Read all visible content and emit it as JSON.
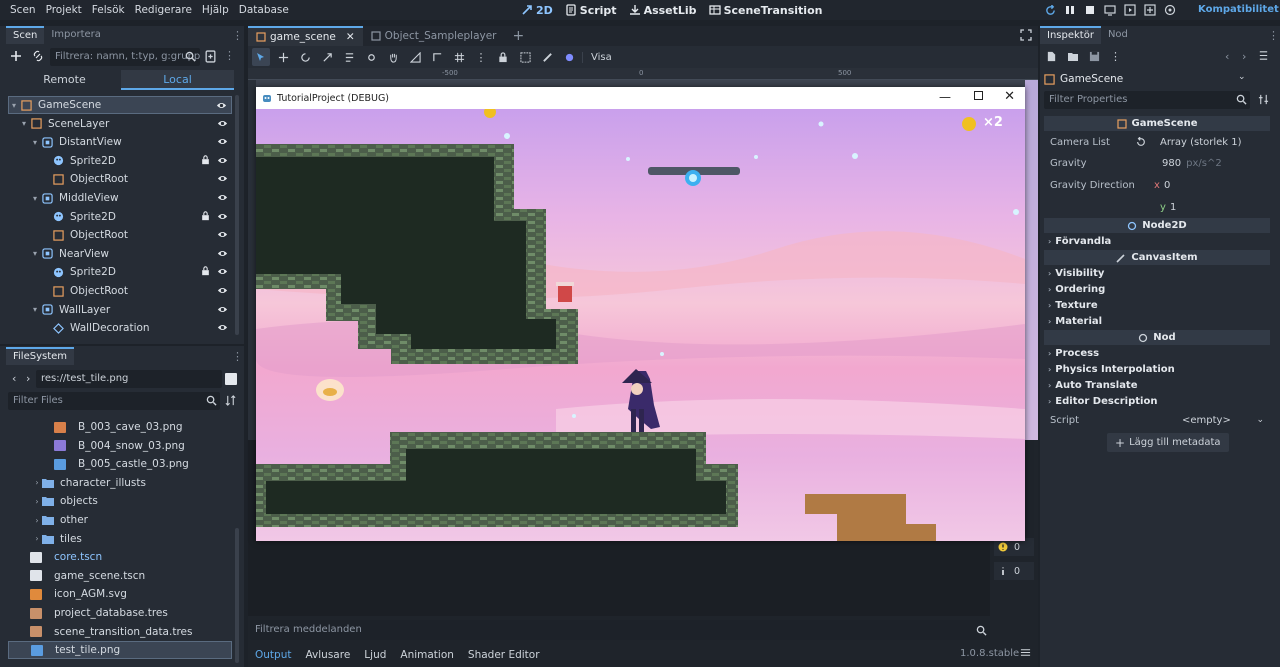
{
  "menu": [
    "Scen",
    "Projekt",
    "Felsök",
    "Redigerare",
    "Hjälp",
    "Database"
  ],
  "workspaces": [
    {
      "label": "2D",
      "icon": "2d-icon",
      "active": true
    },
    {
      "label": "Script",
      "icon": "script-icon",
      "active": false
    },
    {
      "label": "AssetLib",
      "icon": "assetlib-icon",
      "active": false
    },
    {
      "label": "SceneTransition",
      "icon": "scene-transition-icon",
      "active": false
    }
  ],
  "renderer": "Kompatibilitet",
  "scene_dock": {
    "tabs": [
      "Scen",
      "Importera"
    ],
    "filter_placeholder": "Filtrera: namn, t:typ, g:grupp",
    "mode_tabs": [
      "Remote",
      "Local"
    ],
    "tree": [
      {
        "label": "GameScene",
        "icon": "node2d-icon"
      },
      {
        "label": "SceneLayer",
        "icon": "node2d-icon"
      },
      {
        "label": "DistantView",
        "icon": "parallax-icon"
      },
      {
        "label": "Sprite2D",
        "icon": "sprite2d-icon"
      },
      {
        "label": "ObjectRoot",
        "icon": "node2d-icon"
      },
      {
        "label": "MiddleView",
        "icon": "parallax-icon"
      },
      {
        "label": "Sprite2D",
        "icon": "sprite2d-icon"
      },
      {
        "label": "ObjectRoot",
        "icon": "node2d-icon"
      },
      {
        "label": "NearView",
        "icon": "parallax-icon"
      },
      {
        "label": "Sprite2D",
        "icon": "sprite2d-icon"
      },
      {
        "label": "ObjectRoot",
        "icon": "node2d-icon"
      },
      {
        "label": "WallLayer",
        "icon": "parallax-icon"
      },
      {
        "label": "WallDecoration",
        "icon": "tilemap-icon"
      }
    ]
  },
  "filesystem": {
    "tab": "FileSystem",
    "path": "res://test_tile.png",
    "filter_placeholder": "Filter Files",
    "items": [
      {
        "label": "B_003_cave_03.png",
        "icon": "image-icon",
        "color": "#d8804a"
      },
      {
        "label": "B_004_snow_03.png",
        "icon": "image-icon",
        "color": "#8c7ad8"
      },
      {
        "label": "B_005_castle_03.png",
        "icon": "image-icon",
        "color": "#5a9ce0"
      },
      {
        "label": "character_illusts",
        "icon": "folder-icon",
        "color": "#7fb0e8"
      },
      {
        "label": "objects",
        "icon": "folder-icon",
        "color": "#7fb0e8"
      },
      {
        "label": "other",
        "icon": "folder-icon",
        "color": "#7fb0e8"
      },
      {
        "label": "tiles",
        "icon": "folder-icon",
        "color": "#7fb0e8"
      },
      {
        "label": "core.tscn",
        "icon": "scene-icon",
        "color": "#e0e4ea"
      },
      {
        "label": "game_scene.tscn",
        "icon": "scene-icon",
        "color": "#e0e4ea"
      },
      {
        "label": "icon_AGM.svg",
        "icon": "svg-icon",
        "color": "#e08a3c"
      },
      {
        "label": "project_database.tres",
        "icon": "resource-icon",
        "color": "#c8906a"
      },
      {
        "label": "scene_transition_data.tres",
        "icon": "resource-icon",
        "color": "#c8906a"
      },
      {
        "label": "test_tile.png",
        "icon": "image-icon",
        "color": "#5a9ce0"
      }
    ]
  },
  "editor_tabs": [
    {
      "label": "game_scene",
      "active": true
    },
    {
      "label": "Object_Sampleplayer",
      "active": false
    }
  ],
  "toolbar": {
    "view_label": "Visa"
  },
  "ruler": [
    "-500",
    "0",
    "500"
  ],
  "game_window": {
    "title": "TutorialProject (DEBUG)",
    "coin_count": "×2"
  },
  "bottom_panel": {
    "filter_placeholder": "Filtrera meddelanden",
    "tabs": [
      "Output",
      "Avlusare",
      "Ljud",
      "Animation",
      "Shader Editor"
    ],
    "version": "1.0.8.stable",
    "warnings": "0",
    "infos": "0"
  },
  "inspector": {
    "tabs": [
      "Inspektör",
      "Nod"
    ],
    "node_name": "GameScene",
    "filter_placeholder": "Filter Properties",
    "class_header": "GameScene",
    "camera_list_label": "Camera List",
    "camera_list_value": "Array (storlek 1)",
    "gravity_label": "Gravity",
    "gravity_value": "980",
    "gravity_unit": "px/s^2",
    "gravity_dir_label": "Gravity Direction",
    "gravity_x_key": "x",
    "gravity_x": "0",
    "gravity_y_key": "y",
    "gravity_y": "1",
    "node2d_header": "Node2D",
    "node2d_cats": [
      "Förvandla"
    ],
    "canvas_header": "CanvasItem",
    "canvas_cats": [
      "Visibility",
      "Ordering",
      "Texture",
      "Material"
    ],
    "nod_header": "Nod",
    "nod_cats": [
      "Process",
      "Physics Interpolation",
      "Auto Translate",
      "Editor Description"
    ],
    "script_label": "Script",
    "script_value": "<empty>",
    "add_metadata": "Lägg till metadata"
  }
}
